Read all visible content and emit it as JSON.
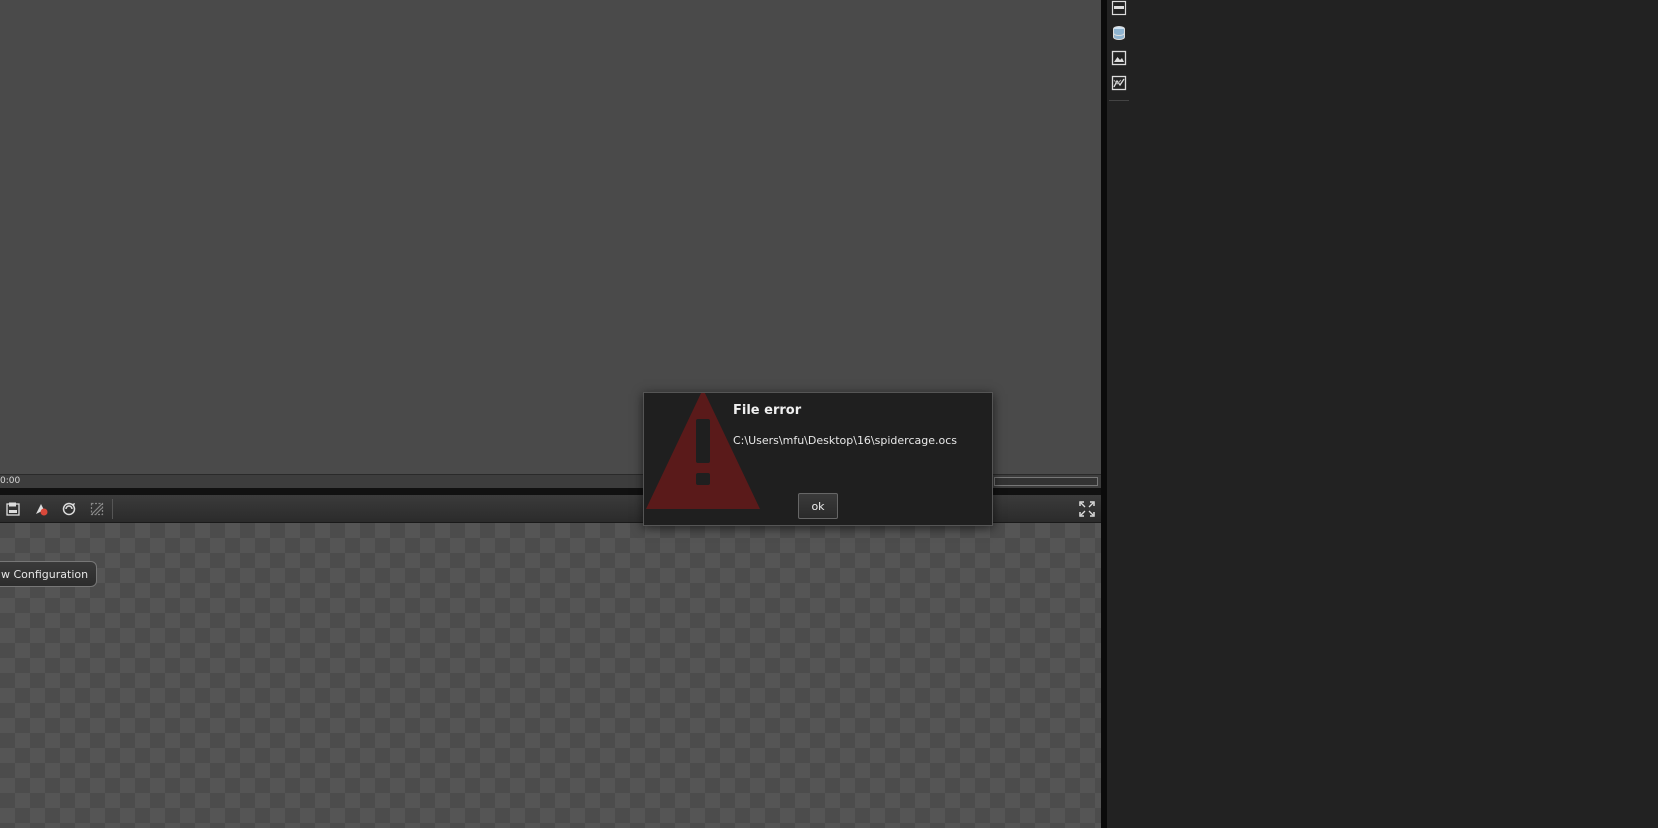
{
  "viewport": {
    "time_label": "0:00"
  },
  "render_toolbar": {
    "buttons": [
      {
        "icon": "save-render-icon"
      },
      {
        "icon": "clay-render-icon"
      },
      {
        "icon": "sub-sample-icon"
      },
      {
        "icon": "region-render-icon"
      }
    ],
    "fullscreen_icon": "fullscreen-icon"
  },
  "render_area": {
    "config_button_label": "w Configuration"
  },
  "side_toolbar": {
    "buttons": [
      {
        "icon": "panel-icon"
      },
      {
        "icon": "database-icon"
      },
      {
        "icon": "image-icon"
      },
      {
        "icon": "graph-icon"
      }
    ]
  },
  "dialog": {
    "title": "File error",
    "message": "C:\\Users\\mfu\\Desktop\\16\\spidercage.ocs",
    "ok_label": "ok"
  },
  "colors": {
    "warning": "#5a1a1a",
    "viewport_bg": "#4a4a4a",
    "panel_bg": "#222222"
  }
}
